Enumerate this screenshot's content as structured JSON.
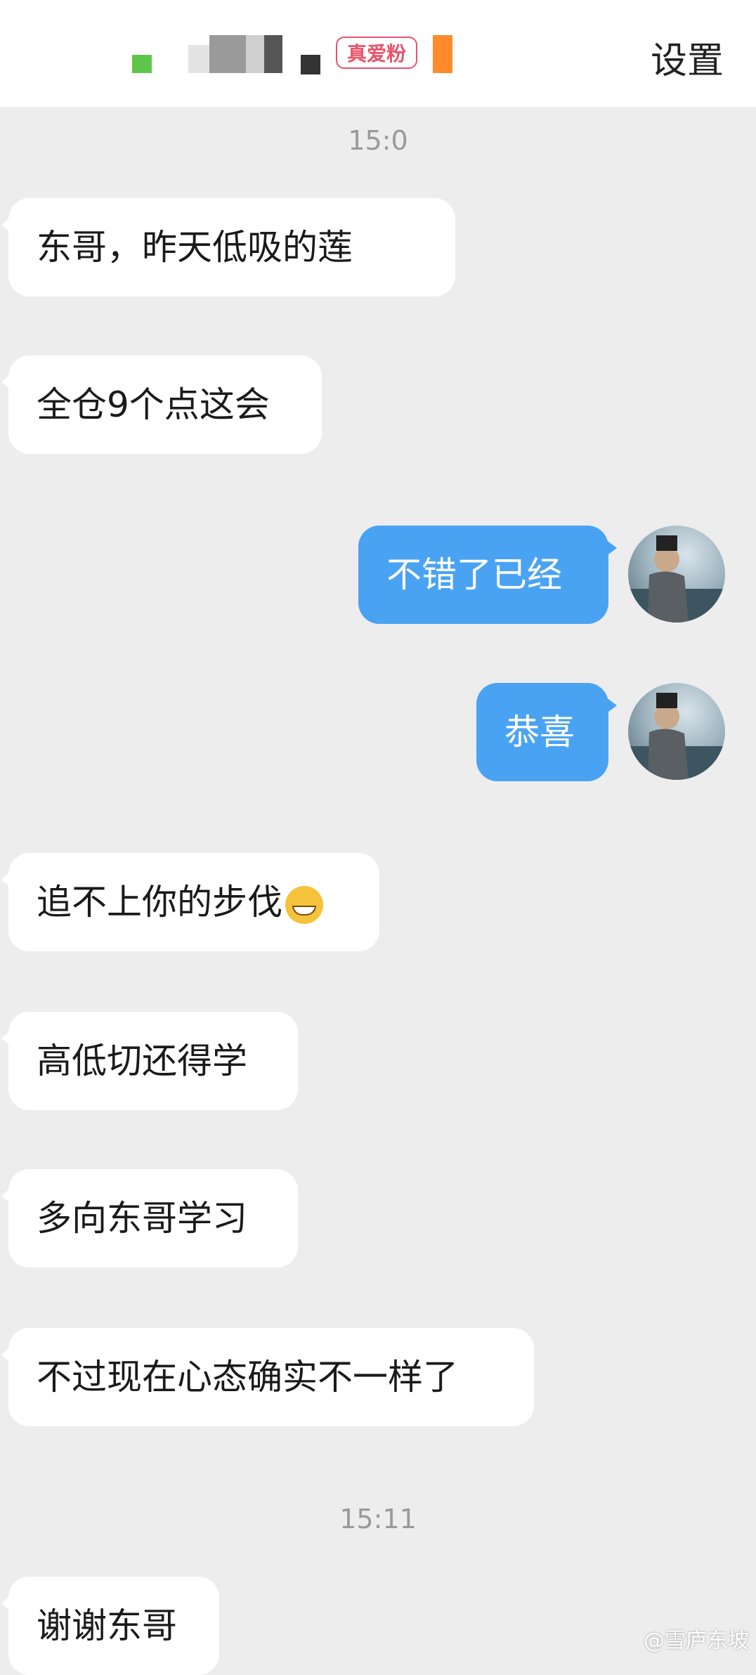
{
  "header": {
    "badge": "真爱粉",
    "settings_label": "设置"
  },
  "messages": [
    {
      "type": "time",
      "text": "15:0"
    },
    {
      "type": "in",
      "text": "东哥，昨天低吸的莲"
    },
    {
      "type": "in",
      "text": "全仓9个点这会"
    },
    {
      "type": "out",
      "text": "不错了已经"
    },
    {
      "type": "out",
      "text": "恭喜"
    },
    {
      "type": "in",
      "text": "追不上你的步伐",
      "emoji": "grin-icon"
    },
    {
      "type": "in",
      "text": "高低切还得学"
    },
    {
      "type": "in",
      "text": "多向东哥学习"
    },
    {
      "type": "in",
      "text": "不过现在心态确实不一样了"
    },
    {
      "type": "time",
      "text": "15:11"
    },
    {
      "type": "in",
      "text": "谢谢东哥"
    }
  ],
  "watermark": "@雪庐东坡"
}
